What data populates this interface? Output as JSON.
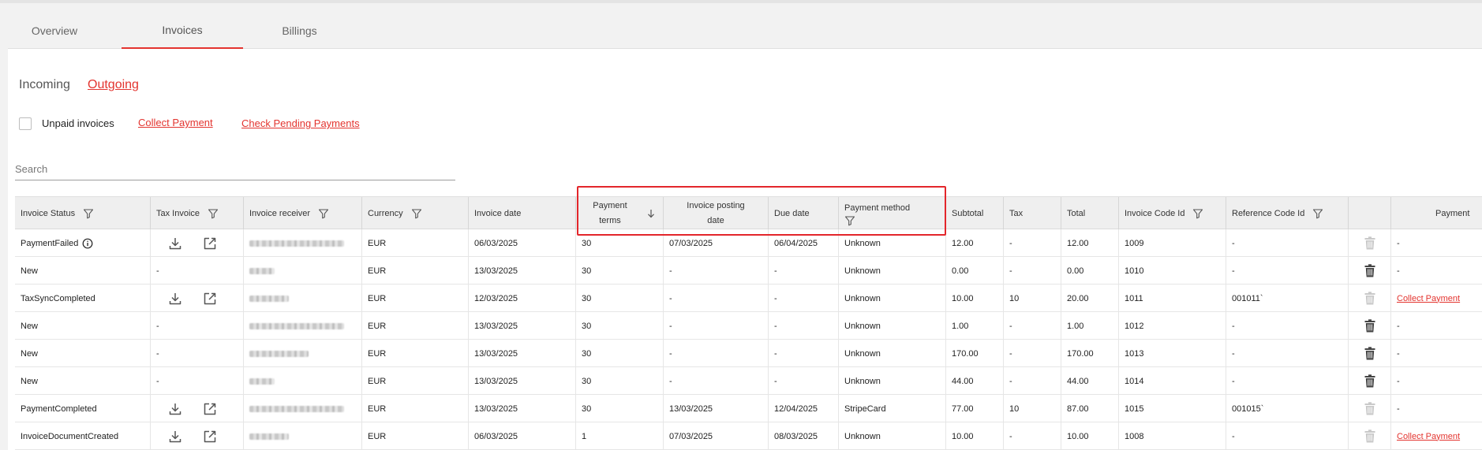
{
  "tabs": [
    {
      "label": "Overview",
      "active": false
    },
    {
      "label": "Invoices",
      "active": true
    },
    {
      "label": "Billings",
      "active": false
    }
  ],
  "subtabs": [
    {
      "label": "Incoming",
      "active": false
    },
    {
      "label": "Outgoing",
      "active": true
    }
  ],
  "filters": {
    "unpaid_label": "Unpaid invoices",
    "unpaid_checked": false,
    "collect_payment": "Collect Payment",
    "check_pending": "Check Pending Payments"
  },
  "search": {
    "placeholder": "Search",
    "value": ""
  },
  "table": {
    "columns": [
      {
        "key": "status",
        "label": "Invoice Status",
        "filter": true
      },
      {
        "key": "tax_invoice",
        "label": "Tax Invoice",
        "filter": true
      },
      {
        "key": "receiver",
        "label": "Invoice receiver",
        "filter": true
      },
      {
        "key": "currency",
        "label": "Currency",
        "filter": true
      },
      {
        "key": "invoice_date",
        "label": "Invoice date",
        "filter": false
      },
      {
        "key": "payment_terms",
        "label": "Payment terms",
        "label_lines": [
          "Payment",
          "terms"
        ],
        "sort": "desc"
      },
      {
        "key": "posting_date",
        "label": "Invoice posting date",
        "label_lines": [
          "Invoice posting",
          "date"
        ]
      },
      {
        "key": "due_date",
        "label": "Due date",
        "filter": false
      },
      {
        "key": "payment_method",
        "label": "Payment method",
        "filter": true
      },
      {
        "key": "subtotal",
        "label": "Subtotal",
        "filter": false
      },
      {
        "key": "tax",
        "label": "Tax",
        "filter": false
      },
      {
        "key": "total",
        "label": "Total",
        "filter": false
      },
      {
        "key": "invoice_code",
        "label": "Invoice Code Id",
        "filter": true
      },
      {
        "key": "reference_code",
        "label": "Reference Code Id",
        "filter": true
      },
      {
        "key": "delete",
        "label": "",
        "filter": false
      },
      {
        "key": "payment",
        "label": "Payment",
        "filter": false
      }
    ],
    "rows": [
      {
        "status": "PaymentFailed",
        "status_info": true,
        "tax_invoice": "icons",
        "receiver_redacted": "long",
        "currency": "EUR",
        "invoice_date": "06/03/2025",
        "payment_terms": "30",
        "posting_date": "07/03/2025",
        "due_date": "06/04/2025",
        "payment_method": "Unknown",
        "subtotal": "12.00",
        "tax": "-",
        "total": "12.00",
        "invoice_code": "1009",
        "reference_code": "-",
        "delete_enabled": false,
        "payment": "-",
        "payment_is_link": false
      },
      {
        "status": "New",
        "status_info": false,
        "tax_invoice": "-",
        "receiver_redacted": "short",
        "currency": "EUR",
        "invoice_date": "13/03/2025",
        "payment_terms": "30",
        "posting_date": "-",
        "due_date": "-",
        "payment_method": "Unknown",
        "subtotal": "0.00",
        "tax": "-",
        "total": "0.00",
        "invoice_code": "1010",
        "reference_code": "-",
        "delete_enabled": true,
        "payment": "-",
        "payment_is_link": false
      },
      {
        "status": "TaxSyncCompleted",
        "status_info": false,
        "tax_invoice": "icons",
        "receiver_redacted": "medium",
        "currency": "EUR",
        "invoice_date": "12/03/2025",
        "payment_terms": "30",
        "posting_date": "-",
        "due_date": "-",
        "payment_method": "Unknown",
        "subtotal": "10.00",
        "tax": "10",
        "total": "20.00",
        "invoice_code": "1011",
        "reference_code": "001011`",
        "delete_enabled": false,
        "payment": "Collect Payment",
        "payment_is_link": true
      },
      {
        "status": "New",
        "status_info": false,
        "tax_invoice": "-",
        "receiver_redacted": "long",
        "currency": "EUR",
        "invoice_date": "13/03/2025",
        "payment_terms": "30",
        "posting_date": "-",
        "due_date": "-",
        "payment_method": "Unknown",
        "subtotal": "1.00",
        "tax": "-",
        "total": "1.00",
        "invoice_code": "1012",
        "reference_code": "-",
        "delete_enabled": true,
        "payment": "-",
        "payment_is_link": false
      },
      {
        "status": "New",
        "status_info": false,
        "tax_invoice": "-",
        "receiver_redacted": "mid",
        "currency": "EUR",
        "invoice_date": "13/03/2025",
        "payment_terms": "30",
        "posting_date": "-",
        "due_date": "-",
        "payment_method": "Unknown",
        "subtotal": "170.00",
        "tax": "-",
        "total": "170.00",
        "invoice_code": "1013",
        "reference_code": "-",
        "delete_enabled": true,
        "payment": "-",
        "payment_is_link": false
      },
      {
        "status": "New",
        "status_info": false,
        "tax_invoice": "-",
        "receiver_redacted": "short",
        "currency": "EUR",
        "invoice_date": "13/03/2025",
        "payment_terms": "30",
        "posting_date": "-",
        "due_date": "-",
        "payment_method": "Unknown",
        "subtotal": "44.00",
        "tax": "-",
        "total": "44.00",
        "invoice_code": "1014",
        "reference_code": "-",
        "delete_enabled": true,
        "payment": "-",
        "payment_is_link": false
      },
      {
        "status": "PaymentCompleted",
        "status_info": false,
        "tax_invoice": "icons",
        "receiver_redacted": "long",
        "currency": "EUR",
        "invoice_date": "13/03/2025",
        "payment_terms": "30",
        "posting_date": "13/03/2025",
        "due_date": "12/04/2025",
        "payment_method": "StripeCard",
        "subtotal": "77.00",
        "tax": "10",
        "total": "87.00",
        "invoice_code": "1015",
        "reference_code": "001015`",
        "delete_enabled": false,
        "payment": "-",
        "payment_is_link": false
      },
      {
        "status": "InvoiceDocumentCreated",
        "status_info": false,
        "tax_invoice": "icons",
        "receiver_redacted": "medium",
        "currency": "EUR",
        "invoice_date": "06/03/2025",
        "payment_terms": "1",
        "posting_date": "07/03/2025",
        "due_date": "08/03/2025",
        "payment_method": "Unknown",
        "subtotal": "10.00",
        "tax": "-",
        "total": "10.00",
        "invoice_code": "1008",
        "reference_code": "-",
        "delete_enabled": false,
        "payment": "Collect Payment",
        "payment_is_link": true
      }
    ]
  },
  "colors": {
    "accent": "#e3342f",
    "highlight_border": "#e3262b",
    "header_bg": "#efefef",
    "page_bg": "#f2f2f2"
  }
}
